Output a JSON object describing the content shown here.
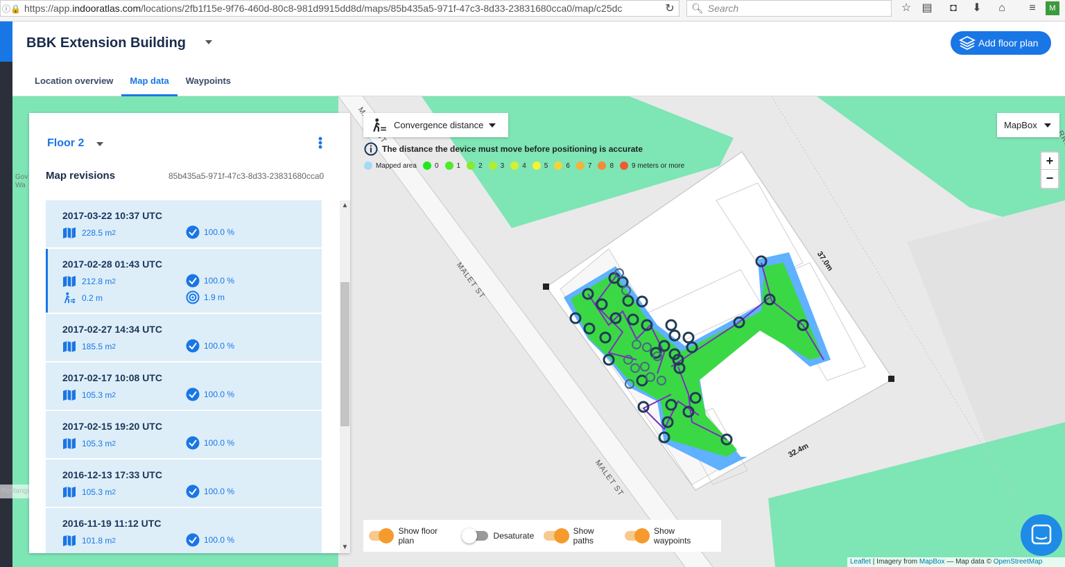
{
  "browser": {
    "url_prefix": "https://app.",
    "url_host": "indooratlas.com",
    "url_path": "/locations/2fb1f15e-9f76-460d-80c8-981d9915dd8d/maps/85b435a5-971f-47c3-8d33-23831680cca0/map/c25dc",
    "search_placeholder": "Search"
  },
  "header": {
    "building": "BBK Extension Building",
    "add_floor_plan": "Add floor plan",
    "tabs": [
      {
        "label": "Location overview",
        "active": false
      },
      {
        "label": "Map data",
        "active": true
      },
      {
        "label": "Waypoints",
        "active": false
      }
    ]
  },
  "panel": {
    "floor": "Floor 2",
    "revisions_title": "Map revisions",
    "revision_id": "85b435a5-971f-47c3-8d33-23831680cca0",
    "revisions": [
      {
        "date": "2017-03-22 10:37 UTC",
        "area": "228.5 m",
        "coverage": "100.0 %",
        "selected": false
      },
      {
        "date": "2017-02-28 01:43 UTC",
        "area": "212.8 m",
        "coverage": "100.0 %",
        "convergence": "0.2 m",
        "accuracy": "1.9 m",
        "selected": true
      },
      {
        "date": "2017-02-27 14:34 UTC",
        "area": "185.5 m",
        "coverage": "100.0 %",
        "selected": false
      },
      {
        "date": "2017-02-17 10:08 UTC",
        "area": "105.3 m",
        "coverage": "100.0 %",
        "selected": false
      },
      {
        "date": "2017-02-15 19:20 UTC",
        "area": "105.3 m",
        "coverage": "100.0 %",
        "selected": false
      },
      {
        "date": "2016-12-13 17:33 UTC",
        "area": "105.3 m",
        "coverage": "100.0 %",
        "selected": false
      },
      {
        "date": "2016-11-19 11:12 UTC",
        "area": "101.8 m",
        "coverage": "100.0 %",
        "selected": false
      }
    ],
    "area_superscript": "2"
  },
  "map": {
    "convergence_label": "Convergence distance",
    "info_text": "The distance the device must move before positioning is accurate",
    "legend": [
      {
        "label": "Mapped area",
        "color": "#a8d8f8"
      },
      {
        "label": "0",
        "color": "#1ee81e"
      },
      {
        "label": "1",
        "color": "#4cec2a"
      },
      {
        "label": "2",
        "color": "#86ec2e"
      },
      {
        "label": "3",
        "color": "#b0ee32"
      },
      {
        "label": "4",
        "color": "#d2f034"
      },
      {
        "label": "5",
        "color": "#f4f432"
      },
      {
        "label": "6",
        "color": "#f6d23a"
      },
      {
        "label": "7",
        "color": "#f6b03c"
      },
      {
        "label": "8",
        "color": "#f28a3c"
      },
      {
        "label": "9 meters or more",
        "color": "#f05a32"
      }
    ],
    "basemap": "MapBox",
    "zoom_in": "+",
    "zoom_out": "−",
    "street_1": "MALET ST",
    "street_2": "MALET ST",
    "street_3": "MALET ST",
    "street_4": "RRING",
    "width_label": "32.4m",
    "height_label": "37.0m",
    "gov_label_1": "Gov",
    "gov_label_2": "Wa",
    "snip_label": "Rectangular Snip",
    "toggles": [
      {
        "label": "Show floor plan",
        "on": true
      },
      {
        "label": "Desaturate",
        "on": false
      },
      {
        "label": "Show paths",
        "on": true
      },
      {
        "label": "Show waypoints",
        "on": true
      }
    ],
    "attribution": {
      "leaflet": "Leaflet",
      "imagery": " | Imagery from ",
      "mapbox": "MapBox",
      "mapdata": " — Map data © ",
      "osm": "OpenStreetMap"
    }
  },
  "colors": {
    "accent": "#1976e5",
    "park": "#7ee5b5",
    "path": "#7b2fbf",
    "waypoint": "#1f3b55"
  }
}
